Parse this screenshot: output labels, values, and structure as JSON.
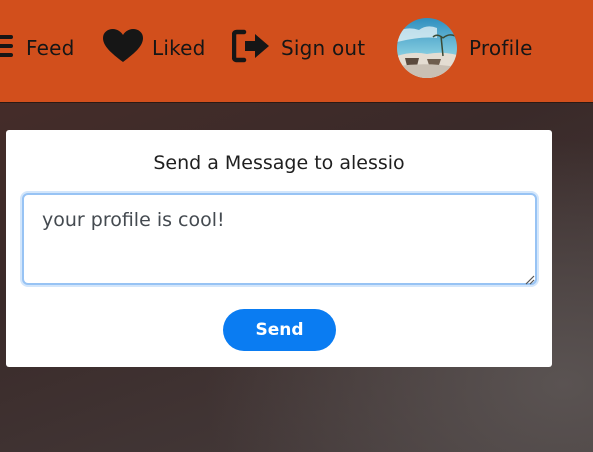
{
  "navbar": {
    "items": [
      {
        "label": "Feed",
        "icon": "menu-icon"
      },
      {
        "label": "Liked",
        "icon": "heart-icon"
      },
      {
        "label": "Sign out",
        "icon": "sign-out-icon"
      },
      {
        "label": "Profile",
        "icon": "avatar"
      }
    ],
    "background": "#d24f1c"
  },
  "message_form": {
    "title": "Send a Message to alessio",
    "message_value": "your profile is cool!",
    "send_label": "Send",
    "accent": "#0a7cf2"
  }
}
